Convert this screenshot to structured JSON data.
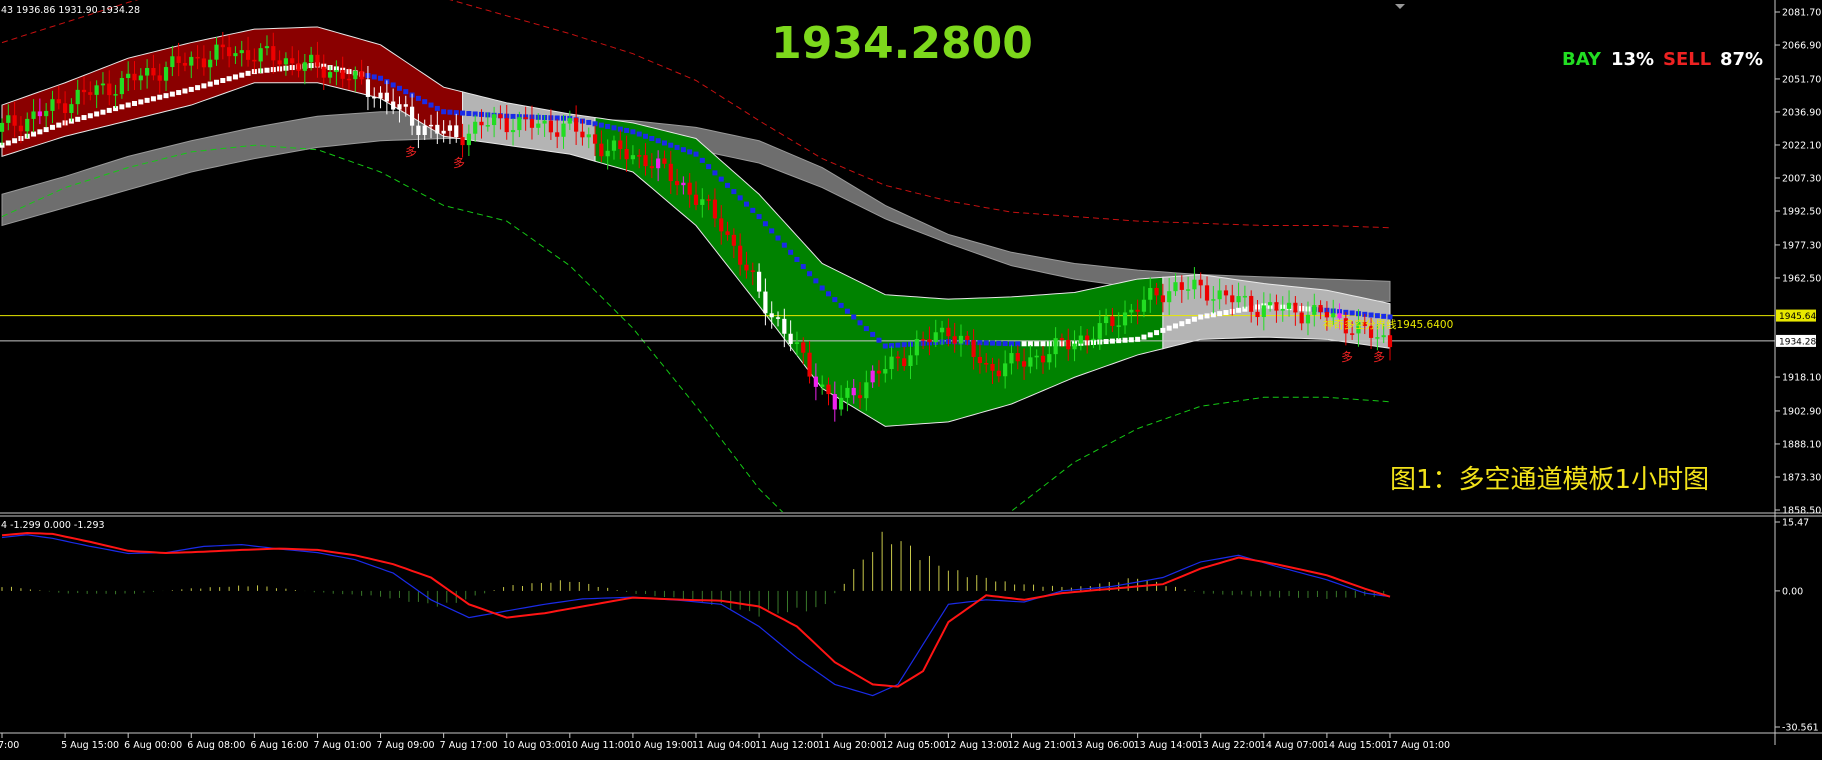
{
  "main_header": "43 1936.86 1931.90 1934.28",
  "sub_header": "4 -1.299 0.000 -1.293",
  "big_price": "1934.2800",
  "caption": "图1：多空通道模板1小时图",
  "sentiment": {
    "bay_label": "BAY",
    "bay_value": "13%",
    "sell_label": "SELL",
    "sell_value": "87%"
  },
  "level_label": "神奇多空分界线1945.6400",
  "multi_marker": "多",
  "colors": {
    "up": "#22dd22",
    "down": "#ee0000",
    "white": "#ffffff",
    "magenta": "#ee22ee",
    "blue": "#1a2be8",
    "level": "#e8e800"
  },
  "chart_data": [
    {
      "type": "line",
      "panel": "price",
      "y_ticks": [
        "2081.70",
        "2066.90",
        "2051.70",
        "2036.90",
        "2022.10",
        "2007.30",
        "1992.50",
        "1977.30",
        "1962.50",
        "1918.10",
        "1902.90",
        "1888.10",
        "1873.30",
        "1858.50"
      ],
      "price_tags": [
        {
          "label": "1945.64",
          "value": 1945.64
        },
        {
          "label": "1934.28",
          "value": 1934.28
        }
      ],
      "ylim": [
        1858.5,
        2081.7
      ],
      "x_ticks": [
        "7:00",
        "5 Aug 15:00",
        "6 Aug 00:00",
        "6 Aug 08:00",
        "6 Aug 16:00",
        "7 Aug 01:00",
        "7 Aug 09:00",
        "7 Aug 17:00",
        "10 Aug 03:00",
        "10 Aug 11:00",
        "10 Aug 19:00",
        "11 Aug 04:00",
        "11 Aug 12:00",
        "11 Aug 20:00",
        "12 Aug 05:00",
        "12 Aug 13:00",
        "12 Aug 21:00",
        "13 Aug 06:00",
        "13 Aug 14:00",
        "13 Aug 22:00",
        "14 Aug 07:00",
        "14 Aug 15:00",
        "17 Aug 01:00"
      ],
      "x_index": [
        0,
        10,
        20,
        30,
        40,
        50,
        60,
        70,
        80,
        90,
        100,
        110,
        120,
        130,
        140,
        150,
        160,
        170,
        180,
        190,
        200,
        210,
        220
      ],
      "series": [
        {
          "role": "close",
          "x": [
            0,
            6,
            12,
            18,
            24,
            30,
            36,
            42,
            48,
            54,
            60,
            66,
            72,
            78,
            84,
            90,
            96,
            102,
            108,
            114,
            120,
            126,
            132,
            138,
            144,
            150,
            156,
            162,
            168,
            174,
            180,
            186,
            192,
            198,
            204,
            210,
            216,
            220
          ],
          "values": [
            2030,
            2036,
            2044,
            2049,
            2055,
            2060,
            2064,
            2062,
            2058,
            2054,
            2044,
            2031,
            2026,
            2033,
            2031,
            2030,
            2020,
            2016,
            2004,
            1987,
            1955,
            1930,
            1905,
            1918,
            1930,
            1940,
            1922,
            1925,
            1932,
            1939,
            1950,
            1959,
            1956,
            1950,
            1948,
            1946,
            1938,
            1934
          ]
        },
        {
          "role": "mid",
          "x": [
            0,
            10,
            20,
            30,
            40,
            50,
            60,
            70,
            80,
            90,
            100,
            110,
            120,
            130,
            140,
            150,
            160,
            170,
            180,
            190,
            200,
            210,
            220
          ],
          "values": [
            2022,
            2032,
            2040,
            2047,
            2055,
            2058,
            2052,
            2037,
            2035,
            2034,
            2028,
            2018,
            1990,
            1958,
            1932,
            1934,
            1933,
            1933,
            1935,
            1945,
            1950,
            1948,
            1945
          ]
        },
        {
          "role": "upper_band",
          "x": [
            0,
            10,
            20,
            30,
            40,
            50,
            60,
            70,
            80,
            90,
            100,
            110,
            120,
            130,
            140,
            150,
            160,
            170,
            180,
            190,
            200,
            210,
            220
          ],
          "values": [
            2040,
            2050,
            2061,
            2068,
            2074,
            2075,
            2067,
            2048,
            2041,
            2036,
            2032,
            2025,
            2000,
            1969,
            1955,
            1953,
            1954,
            1956,
            1962,
            1964,
            1960,
            1957,
            1951
          ]
        },
        {
          "role": "lower_band",
          "x": [
            0,
            10,
            20,
            30,
            40,
            50,
            60,
            70,
            80,
            90,
            100,
            110,
            120,
            130,
            140,
            150,
            160,
            170,
            180,
            190,
            200,
            210,
            220
          ],
          "values": [
            2017,
            2026,
            2033,
            2040,
            2050,
            2050,
            2043,
            2026,
            2022,
            2018,
            2010,
            1986,
            1950,
            1913,
            1896,
            1898,
            1906,
            1918,
            1928,
            1935,
            1936,
            1935,
            1931
          ]
        },
        {
          "role": "gray_upper",
          "x": [
            0,
            10,
            20,
            30,
            40,
            50,
            60,
            70,
            80,
            90,
            100,
            110,
            120,
            130,
            140,
            150,
            160,
            170,
            180,
            190,
            200,
            210,
            220
          ],
          "values": [
            2000,
            2008,
            2017,
            2024,
            2030,
            2035,
            2037,
            2037,
            2036,
            2034,
            2033,
            2030,
            2024,
            2012,
            1995,
            1982,
            1974,
            1969,
            1966,
            1964,
            1963,
            1962,
            1961
          ]
        },
        {
          "role": "gray_lower",
          "x": [
            0,
            10,
            20,
            30,
            40,
            50,
            60,
            70,
            80,
            90,
            100,
            110,
            120,
            130,
            140,
            150,
            160,
            170,
            180,
            190,
            200,
            210,
            220
          ],
          "values": [
            1986,
            1994,
            2002,
            2010,
            2016,
            2021,
            2024,
            2025,
            2025,
            2024,
            2022,
            2020,
            2014,
            2003,
            1989,
            1978,
            1968,
            1962,
            1958,
            1955,
            1954,
            1953,
            1952
          ]
        },
        {
          "role": "red_dashed",
          "x": [
            0,
            10,
            20,
            30,
            40,
            50,
            60,
            70,
            80,
            90,
            100,
            110,
            120,
            130,
            140,
            150,
            160,
            170,
            180,
            190,
            200,
            210,
            220
          ],
          "values": [
            2068,
            2077,
            2086,
            2094,
            2100,
            2102,
            2098,
            2088,
            2080,
            2072,
            2063,
            2051,
            2033,
            2016,
            2004,
            1997,
            1992,
            1990,
            1988,
            1987,
            1986,
            1986,
            1985
          ]
        },
        {
          "role": "green_dashed",
          "x": [
            0,
            10,
            20,
            30,
            40,
            50,
            60,
            70,
            80,
            90,
            100,
            110,
            120,
            130,
            140,
            150,
            160,
            170,
            180,
            190,
            200,
            210,
            220
          ],
          "values": [
            1990,
            2003,
            2012,
            2019,
            2022,
            2020,
            2010,
            1995,
            1988,
            1968,
            1940,
            1905,
            1868,
            1840,
            1827,
            1832,
            1858,
            1880,
            1895,
            1905,
            1909,
            1909,
            1907
          ]
        }
      ]
    },
    {
      "type": "line",
      "panel": "oscillator",
      "y_ticks": [
        "15.47",
        "0.00",
        "-30.561"
      ],
      "ylim": [
        -30.561,
        15.47
      ],
      "series": [
        {
          "role": "signal",
          "x": [
            0,
            4,
            8,
            14,
            20,
            26,
            32,
            38,
            44,
            50,
            56,
            62,
            68,
            74,
            80,
            86,
            92,
            100,
            108,
            114,
            120,
            126,
            132,
            138,
            142,
            146,
            150,
            156,
            162,
            168,
            176,
            184,
            190,
            196,
            202,
            210,
            216,
            220
          ],
          "values": [
            12.5,
            13,
            12.8,
            11,
            9,
            8.5,
            8.8,
            9.2,
            9.5,
            9.2,
            8,
            6,
            3,
            -3,
            -6,
            -5,
            -3.5,
            -1.5,
            -2,
            -2.2,
            -3.5,
            -8,
            -16,
            -21,
            -21.5,
            -18,
            -7,
            -1,
            -2,
            -0.5,
            0.5,
            1.5,
            5,
            7.5,
            6,
            3.5,
            0.5,
            -1.3
          ]
        },
        {
          "role": "main",
          "x": [
            0,
            4,
            8,
            14,
            20,
            26,
            32,
            38,
            44,
            50,
            56,
            62,
            68,
            74,
            80,
            86,
            92,
            100,
            108,
            114,
            120,
            126,
            132,
            138,
            142,
            146,
            150,
            156,
            162,
            168,
            176,
            184,
            190,
            196,
            202,
            210,
            216,
            220
          ],
          "values": [
            12,
            12.6,
            11.8,
            10,
            8.4,
            8.6,
            10,
            10.4,
            9.4,
            8.6,
            7,
            4,
            -2,
            -6,
            -4.5,
            -3,
            -1.8,
            -1.4,
            -2.2,
            -3,
            -8,
            -15,
            -21,
            -23.5,
            -21,
            -12,
            -3,
            -2,
            -2.5,
            0,
            1,
            3,
            6.5,
            8,
            5.5,
            2.5,
            -0.5,
            -1.3
          ]
        },
        {
          "role": "histogram",
          "x": [
            0,
            10,
            20,
            30,
            40,
            50,
            60,
            70,
            80,
            90,
            100,
            110,
            120,
            130,
            140,
            150,
            160,
            170,
            180,
            190,
            200,
            210,
            220
          ],
          "values": [
            1.2,
            -0.6,
            -0.8,
            0.6,
            1.4,
            -0.4,
            -1.4,
            -3.8,
            1.2,
            2.6,
            -0.6,
            -2.4,
            -5.8,
            -4.2,
            14.2,
            5.2,
            1.8,
            0.8,
            3.2,
            -0.6,
            -1.4,
            -1.8,
            -1.3
          ]
        }
      ]
    }
  ]
}
